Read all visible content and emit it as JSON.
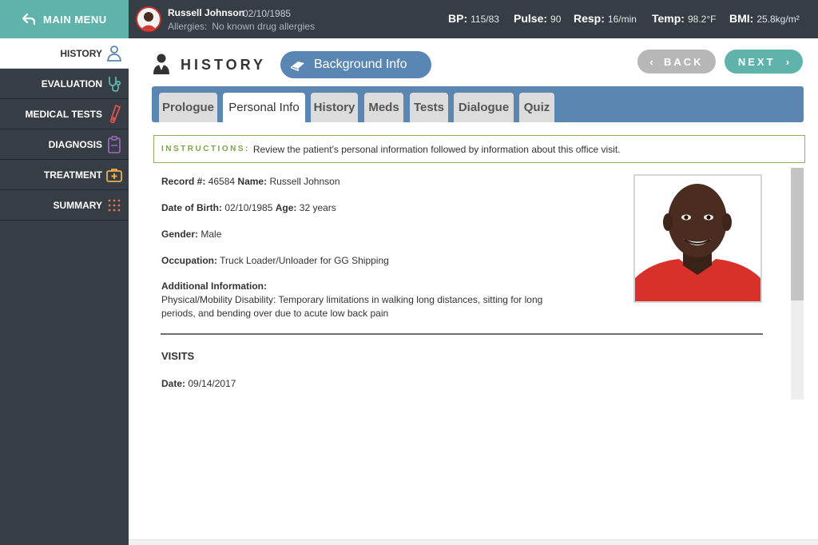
{
  "header": {
    "main_menu_label": "MAIN MENU",
    "patient_name": "Russell Johnson",
    "patient_dob": "02/10/1985",
    "allergies_label": "Allergies:",
    "allergies_value": "No known drug allergies",
    "vitals": [
      {
        "label": "BP:",
        "value": "115/83"
      },
      {
        "label": "Pulse:",
        "value": "90"
      },
      {
        "label": "Resp:",
        "value": "16/min"
      },
      {
        "label": "Temp:",
        "value": "98.2°F"
      },
      {
        "label": "BMI:",
        "value": "25.8kg/m²"
      }
    ]
  },
  "sidebar": {
    "items": [
      {
        "label": "HISTORY",
        "icon": "person-icon",
        "active": true,
        "color": "#5a86b3"
      },
      {
        "label": "EVALUATION",
        "icon": "stethoscope-icon",
        "active": false,
        "color": "#5fb3aa"
      },
      {
        "label": "MEDICAL TESTS",
        "icon": "test-tube-icon",
        "active": false,
        "color": "#d9534f"
      },
      {
        "label": "DIAGNOSIS",
        "icon": "clipboard-icon",
        "active": false,
        "color": "#a36bc4"
      },
      {
        "label": "TREATMENT",
        "icon": "medkit-icon",
        "active": false,
        "color": "#f0ad4e"
      },
      {
        "label": "SUMMARY",
        "icon": "dots-grid-icon",
        "active": false,
        "color": "#e8734a"
      }
    ]
  },
  "main": {
    "title": "HISTORY",
    "background_button": "Background Info",
    "back_label": "BACK",
    "next_label": "NEXT",
    "tabs": [
      {
        "label": "Prologue",
        "active": false
      },
      {
        "label": "Personal Info",
        "active": true
      },
      {
        "label": "History",
        "active": false
      },
      {
        "label": "Meds",
        "active": false
      },
      {
        "label": "Tests",
        "active": false
      },
      {
        "label": "Dialogue",
        "active": false
      },
      {
        "label": "Quiz",
        "active": false
      }
    ],
    "instructions_label": "INSTRUCTIONS:",
    "instructions_text": "Review the patient's personal information followed by information about this office visit."
  },
  "record": {
    "record_label": "Record #:",
    "record_number": "46584",
    "name_label": "Name:",
    "name": "Russell Johnson",
    "dob_label": "Date of Birth:",
    "dob": "02/10/1985",
    "age_label": "Age:",
    "age": "32 years",
    "gender_label": "Gender:",
    "gender": "Male",
    "occupation_label": "Occupation:",
    "occupation": "Truck Loader/Unloader for GG Shipping",
    "additional_label": "Additional Information:",
    "additional_text": "Physical/Mobility Disability: Temporary limitations in walking long distances, sitting for long periods, and bending over due to acute low back pain"
  },
  "visits": {
    "heading": "VISITS",
    "date_label": "Date:",
    "date": "09/14/2017"
  },
  "colors": {
    "sidebar_bg": "#363d45",
    "accent_teal": "#5fb3aa",
    "accent_blue": "#5a86b3",
    "instructions_green": "#7da544"
  }
}
